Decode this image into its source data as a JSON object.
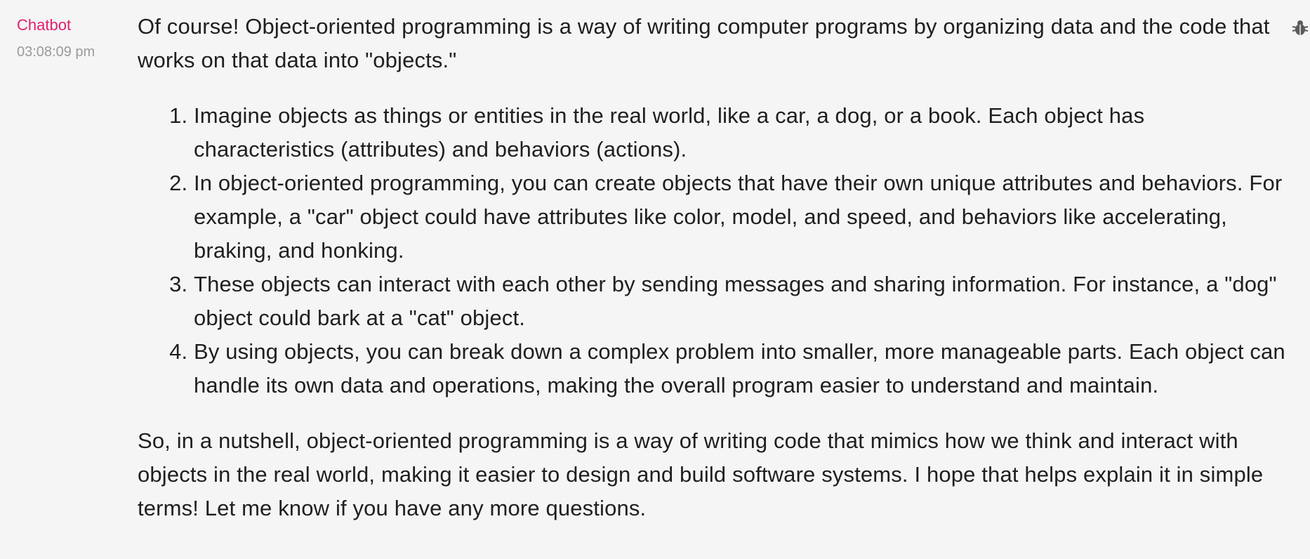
{
  "message": {
    "sender": "Chatbot",
    "timestamp": "03:08:09 pm",
    "intro": "Of course! Object-oriented programming is a way of writing computer programs by organizing data and the code that works on that data into \"objects.\"",
    "points": [
      "Imagine objects as things or entities in the real world, like a car, a dog, or a book. Each object has characteristics (attributes) and behaviors (actions).",
      "In object-oriented programming, you can create objects that have their own unique attributes and behaviors. For example, a \"car\" object could have attributes like color, model, and speed, and behaviors like accelerating, braking, and honking.",
      "These objects can interact with each other by sending messages and sharing information. For instance, a \"dog\" object could bark at a \"cat\" object.",
      "By using objects, you can break down a complex problem into smaller, more manageable parts. Each object can handle its own data and operations, making the overall program easier to understand and maintain."
    ],
    "conclusion": "So, in a nutshell, object-oriented programming is a way of writing code that mimics how we think and interact with objects in the real world, making it easier to design and build software systems. I hope that helps explain it in simple terms! Let me know if you have any more questions.",
    "actions": {
      "debug_icon": "bug-icon"
    }
  },
  "colors": {
    "sender": "#e0216f",
    "timestamp": "#9a9a9a",
    "text": "#1f1f1f",
    "background": "#f5f5f5"
  }
}
